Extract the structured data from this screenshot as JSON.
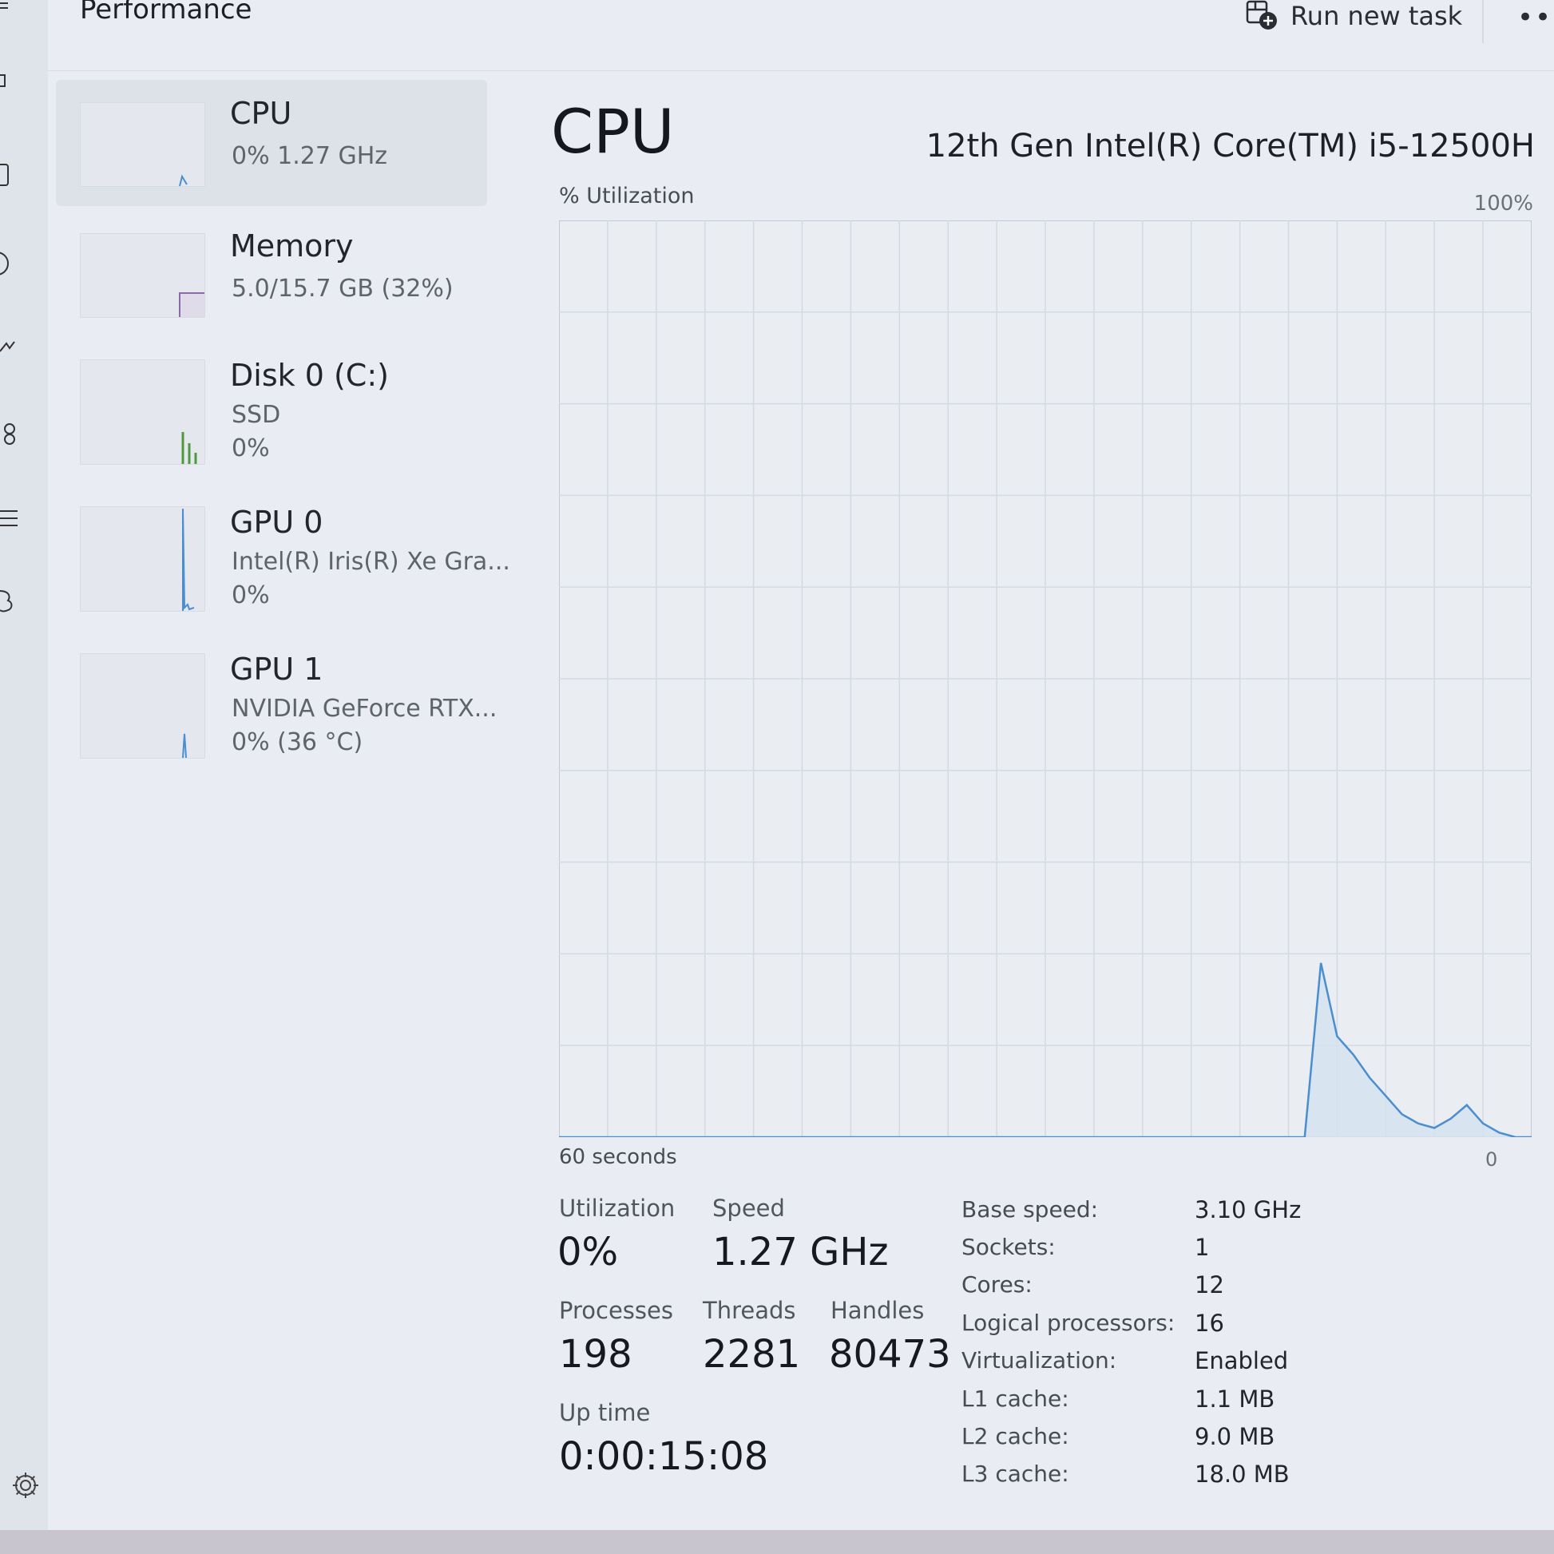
{
  "header": {
    "title": "Performance",
    "run_new_task": "Run new task",
    "more": "•••"
  },
  "rail": {
    "icons": [
      "menu-icon",
      "processes-icon",
      "performance-icon",
      "app-history-icon",
      "startup-icon",
      "users-icon",
      "details-icon",
      "services-icon",
      "settings-icon"
    ]
  },
  "sidebar": {
    "items": [
      {
        "title": "CPU",
        "lines": [
          "0% 1.27 GHz"
        ]
      },
      {
        "title": "Memory",
        "lines": [
          "5.0/15.7 GB (32%)"
        ]
      },
      {
        "title": "Disk 0 (C:)",
        "lines": [
          "SSD",
          "0%"
        ]
      },
      {
        "title": "GPU 0",
        "lines": [
          "Intel(R) Iris(R) Xe Gra...",
          "0%"
        ]
      },
      {
        "title": "GPU 1",
        "lines": [
          "NVIDIA GeForce RTX...",
          "0% (36 °C)"
        ]
      }
    ]
  },
  "main": {
    "title": "CPU",
    "model": "12th Gen Intel(R) Core(TM) i5-12500H",
    "util_label": "% Utilization",
    "max_label": "100%",
    "time_label": "60 seconds",
    "min_label": "0",
    "accent": "#4a8ed0"
  },
  "stats": {
    "utilization_label": "Utilization",
    "utilization": "0%",
    "speed_label": "Speed",
    "speed": "1.27 GHz",
    "processes_label": "Processes",
    "processes": "198",
    "threads_label": "Threads",
    "threads": "2281",
    "handles_label": "Handles",
    "handles": "80473",
    "uptime_label": "Up time",
    "uptime": "0:00:15:08"
  },
  "specs": [
    {
      "key": "Base speed:",
      "value": "3.10 GHz"
    },
    {
      "key": "Sockets:",
      "value": "1"
    },
    {
      "key": "Cores:",
      "value": "12"
    },
    {
      "key": "Logical processors:",
      "value": "16"
    },
    {
      "key": "Virtualization:",
      "value": "Enabled"
    },
    {
      "key": "L1 cache:",
      "value": "1.1 MB"
    },
    {
      "key": "L2 cache:",
      "value": "9.0 MB"
    },
    {
      "key": "L3 cache:",
      "value": "18.0 MB"
    }
  ],
  "chart_data": {
    "type": "area",
    "x": [
      60,
      14,
      13,
      12,
      11,
      10,
      9,
      8,
      7,
      6,
      5,
      4,
      3,
      2,
      1,
      0
    ],
    "values": [
      0,
      0,
      19,
      11,
      9,
      6.5,
      4.5,
      2.5,
      1.5,
      1,
      2,
      3.5,
      1.5,
      0.5,
      0,
      0
    ],
    "ylim": [
      0,
      100
    ],
    "xlim": [
      60,
      0
    ],
    "grid": true
  }
}
